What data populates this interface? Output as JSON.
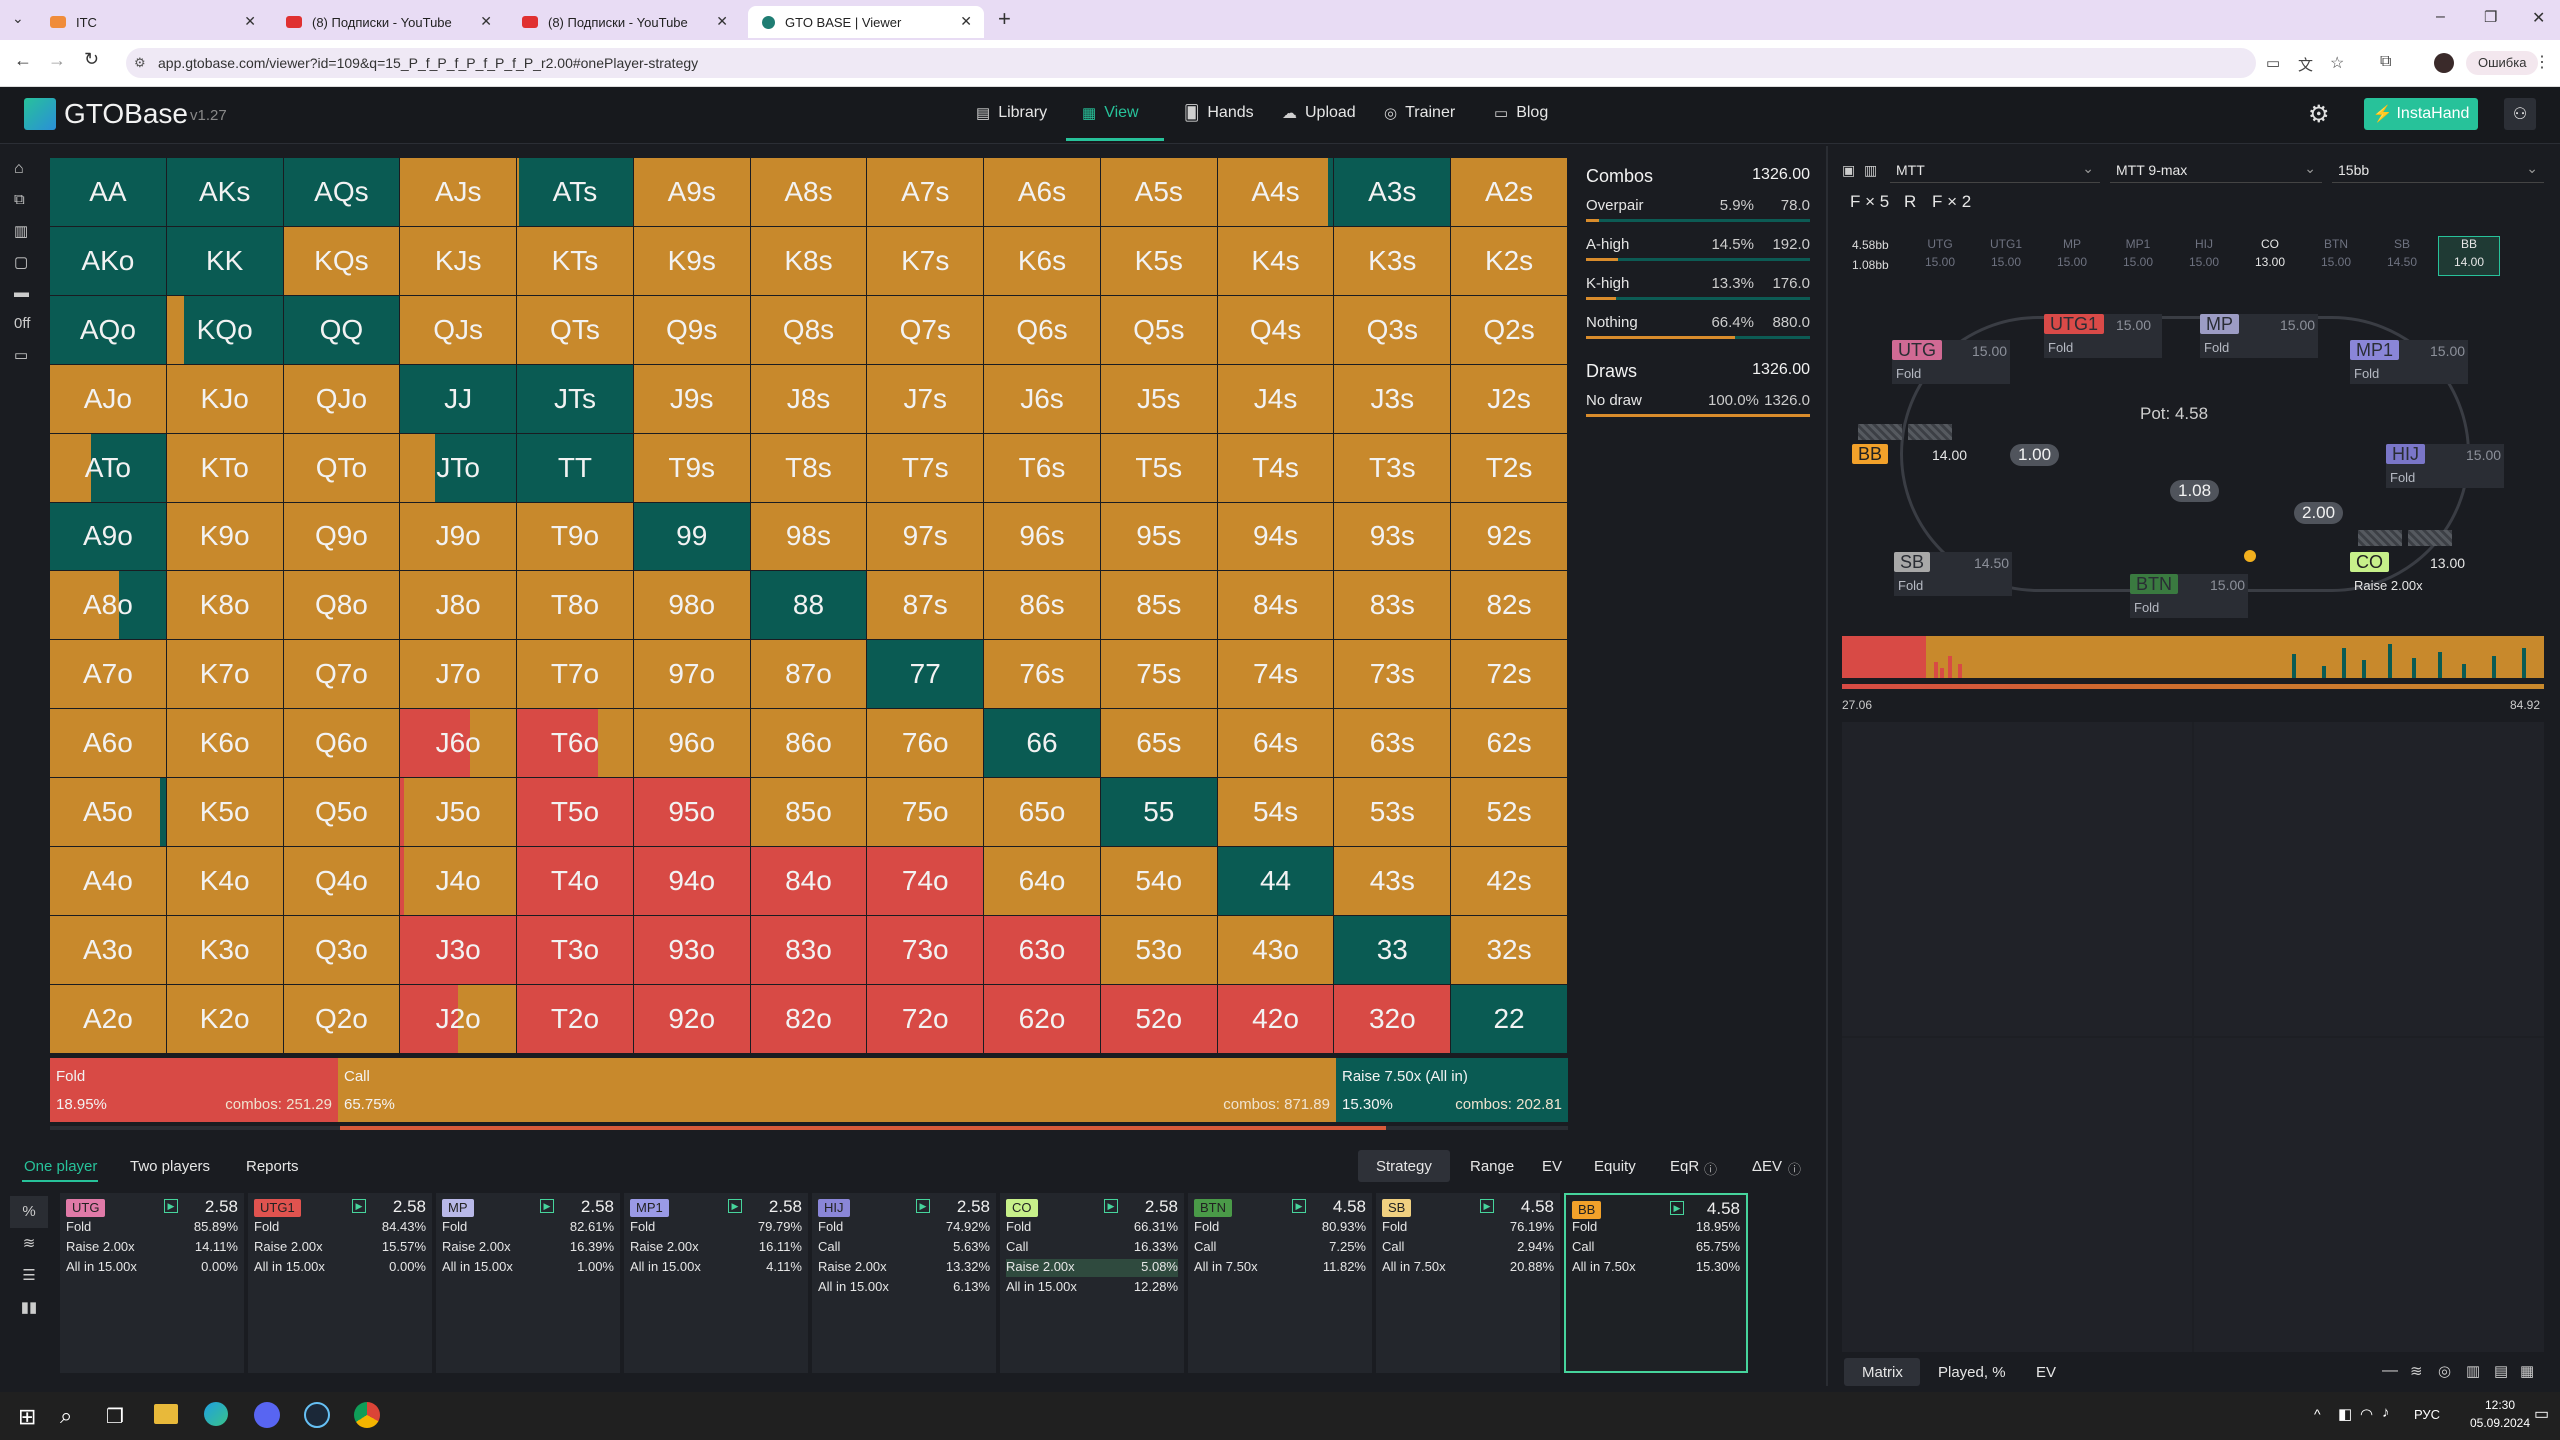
{
  "browser": {
    "tabs": [
      {
        "title": "ITC",
        "fav": "#f08c3a"
      },
      {
        "title": "(8) Подписки - YouTube",
        "fav": "#e03131"
      },
      {
        "title": "(8) Подписки - YouTube",
        "fav": "#e03131"
      },
      {
        "title": "GTO BASE | Viewer",
        "fav": "#1f7d73"
      }
    ],
    "url": "app.gtobase.com/viewer?id=109&q=15_P_f_P_f_P_f_P_f_P_r2.00#onePlayer-strategy",
    "profile_error": "Ошибка"
  },
  "app": {
    "brand": "GTOBase",
    "version": "v1.27",
    "nav": [
      {
        "label": "Library",
        "icon": "library-icon"
      },
      {
        "label": "View",
        "icon": "grid-icon"
      },
      {
        "label": "Hands",
        "icon": "hands-icon"
      },
      {
        "label": "Upload",
        "icon": "cloud-upload-icon"
      },
      {
        "label": "Trainer",
        "icon": "trainer-icon"
      },
      {
        "label": "Blog",
        "icon": "blog-icon"
      }
    ],
    "instahand": "InstaHand",
    "sidebar_text": "0ff"
  },
  "colors": {
    "fold": "#d84a45",
    "call": "#c8892c",
    "raise": "#0a5b53",
    "accent": "#27c29a"
  },
  "matrix": {
    "labels": [
      [
        "AA",
        "AKs",
        "AQs",
        "AJs",
        "ATs",
        "A9s",
        "A8s",
        "A7s",
        "A6s",
        "A5s",
        "A4s",
        "A3s",
        "A2s"
      ],
      [
        "AKo",
        "KK",
        "KQs",
        "KJs",
        "KTs",
        "K9s",
        "K8s",
        "K7s",
        "K6s",
        "K5s",
        "K4s",
        "K3s",
        "K2s"
      ],
      [
        "AQo",
        "KQo",
        "QQ",
        "QJs",
        "QTs",
        "Q9s",
        "Q8s",
        "Q7s",
        "Q6s",
        "Q5s",
        "Q4s",
        "Q3s",
        "Q2s"
      ],
      [
        "AJo",
        "KJo",
        "QJo",
        "JJ",
        "JTs",
        "J9s",
        "J8s",
        "J7s",
        "J6s",
        "J5s",
        "J4s",
        "J3s",
        "J2s"
      ],
      [
        "ATo",
        "KTo",
        "QTo",
        "JTo",
        "TT",
        "T9s",
        "T8s",
        "T7s",
        "T6s",
        "T5s",
        "T4s",
        "T3s",
        "T2s"
      ],
      [
        "A9o",
        "K9o",
        "Q9o",
        "J9o",
        "T9o",
        "99",
        "98s",
        "97s",
        "96s",
        "95s",
        "94s",
        "93s",
        "92s"
      ],
      [
        "A8o",
        "K8o",
        "Q8o",
        "J8o",
        "T8o",
        "98o",
        "88",
        "87s",
        "86s",
        "85s",
        "84s",
        "83s",
        "82s"
      ],
      [
        "A7o",
        "K7o",
        "Q7o",
        "J7o",
        "T7o",
        "97o",
        "87o",
        "77",
        "76s",
        "75s",
        "74s",
        "73s",
        "72s"
      ],
      [
        "A6o",
        "K6o",
        "Q6o",
        "J6o",
        "T6o",
        "96o",
        "86o",
        "76o",
        "66",
        "65s",
        "64s",
        "63s",
        "62s"
      ],
      [
        "A5o",
        "K5o",
        "Q5o",
        "J5o",
        "T5o",
        "95o",
        "85o",
        "75o",
        "65o",
        "55",
        "54s",
        "53s",
        "52s"
      ],
      [
        "A4o",
        "K4o",
        "Q4o",
        "J4o",
        "T4o",
        "94o",
        "84o",
        "74o",
        "64o",
        "54o",
        "44",
        "43s",
        "42s"
      ],
      [
        "A3o",
        "K3o",
        "Q3o",
        "J3o",
        "T3o",
        "93o",
        "83o",
        "73o",
        "63o",
        "53o",
        "43o",
        "33",
        "32s"
      ],
      [
        "A2o",
        "K2o",
        "Q2o",
        "J2o",
        "T2o",
        "92o",
        "82o",
        "72o",
        "62o",
        "52o",
        "42o",
        "32o",
        "22"
      ]
    ],
    "strategy_codes": [
      "GGGOOOOOOOOGO",
      "GGOOOOOOOOOOO",
      "GPGOOOOOOOOOO",
      "OOOGGOOOOOOOO",
      "POOPGOOOOOOOO",
      "GOOOOGOOOOOOO",
      "POOOOOGOOOOOO",
      "OOOOOOOGOOOOO",
      "OOORROOOGOOOO",
      "POORRROOOGOOO",
      "OOORRRRROOGOO",
      "OOORRRRRROOGO",
      "OOORRRRRRRRRG"
    ],
    "mixes": {
      "0,0": {
        "c": 0.0,
        "r": 1.0
      },
      "0,1": {
        "c": 0.0,
        "r": 1.0
      },
      "0,2": {
        "c": 0.0,
        "r": 1.0
      },
      "0,4": {
        "c": 0.02,
        "r": 0.98
      },
      "0,10": {
        "c": 0.95,
        "r": 0.05
      },
      "0,11": {
        "c": 0.0,
        "r": 1.0
      },
      "2,1": {
        "c": 0.15,
        "r": 0.85
      },
      "3,3": {
        "c": 0.0,
        "r": 1.0
      },
      "3,4": {
        "c": 0.0,
        "r": 1.0
      },
      "4,0": {
        "c": 0.35,
        "r": 0.65
      },
      "4,3": {
        "c": 0.3,
        "r": 0.7
      },
      "4,4": {
        "c": 0.0,
        "r": 1.0
      },
      "5,0": {
        "c": 0.0,
        "r": 1.0
      },
      "5,5": {
        "c": 0.0,
        "r": 1.0
      },
      "6,0": {
        "c": 0.6,
        "r": 0.4
      },
      "6,6": {
        "c": 0.0,
        "r": 1.0
      },
      "7,7": {
        "c": 0.0,
        "r": 1.0
      },
      "8,8": {
        "c": 0.0,
        "r": 1.0
      },
      "9,0": {
        "c": 0.95,
        "r": 0.05
      },
      "9,9": {
        "c": 0.0,
        "r": 1.0
      },
      "10,10": {
        "c": 0.0,
        "r": 1.0
      },
      "11,11": {
        "c": 0.0,
        "r": 1.0
      },
      "12,12": {
        "c": 0.0,
        "r": 1.0
      },
      "8,3": {
        "f": 0.6,
        "c": 0.4
      },
      "8,4": {
        "f": 0.7,
        "c": 0.3
      },
      "9,3": {
        "f": 0.03,
        "c": 0.97
      },
      "10,3": {
        "f": 0.03,
        "c": 0.97
      },
      "12,3": {
        "f": 0.5,
        "c": 0.5
      }
    }
  },
  "actions_summary": [
    {
      "name": "Fold",
      "pct": "18.95%",
      "combos": "combos: 251.29",
      "frac": 0.1895
    },
    {
      "name": "Call",
      "pct": "65.75%",
      "combos": "combos: 871.89",
      "frac": 0.6575
    },
    {
      "name": "Raise 7.50x (All in)",
      "pct": "15.30%",
      "combos": "combos: 202.81",
      "frac": 0.153
    }
  ],
  "stats": {
    "combos_title": "Combos",
    "combos_total": "1326.00",
    "rows": [
      {
        "name": "Overpair",
        "pct": "5.9%",
        "combos": "78.0",
        "frac": 0.059
      },
      {
        "name": "A-high",
        "pct": "14.5%",
        "combos": "192.0",
        "frac": 0.145
      },
      {
        "name": "K-high",
        "pct": "13.3%",
        "combos": "176.0",
        "frac": 0.133
      },
      {
        "name": "Nothing",
        "pct": "66.4%",
        "combos": "880.0",
        "frac": 0.664
      }
    ],
    "draws_title": "Draws",
    "draws_total": "1326.00",
    "draw_rows": [
      {
        "name": "No draw",
        "pct": "100.0%",
        "combos": "1326.0",
        "frac": 1.0
      }
    ]
  },
  "bottom_tabs": {
    "left": [
      "One player",
      "Two players",
      "Reports"
    ],
    "right": [
      "Strategy",
      "Range",
      "EV",
      "Equity",
      "EqR",
      "ΔEV"
    ]
  },
  "positions": [
    {
      "name": "UTG",
      "stack": "2.58",
      "color": "#e07aa8",
      "actions": [
        [
          "Fold",
          "85.89%"
        ],
        [
          "Raise 2.00x",
          "14.11%"
        ],
        [
          "All in 15.00x",
          "0.00%"
        ]
      ]
    },
    {
      "name": "UTG1",
      "stack": "2.58",
      "color": "#e0534f",
      "actions": [
        [
          "Fold",
          "84.43%"
        ],
        [
          "Raise 2.00x",
          "15.57%"
        ],
        [
          "All in 15.00x",
          "0.00%"
        ]
      ]
    },
    {
      "name": "MP",
      "stack": "2.58",
      "color": "#b8b8e8",
      "actions": [
        [
          "Fold",
          "82.61%"
        ],
        [
          "Raise 2.00x",
          "16.39%"
        ],
        [
          "All in 15.00x",
          "1.00%"
        ]
      ]
    },
    {
      "name": "MP1",
      "stack": "2.58",
      "color": "#9a9ae6",
      "actions": [
        [
          "Fold",
          "79.79%"
        ],
        [
          "Raise 2.00x",
          "16.11%"
        ],
        [
          "All in 15.00x",
          "4.11%"
        ]
      ]
    },
    {
      "name": "HIJ",
      "stack": "2.58",
      "color": "#8a86d8",
      "actions": [
        [
          "Fold",
          "74.92%"
        ],
        [
          "Call",
          "5.63%"
        ],
        [
          "Raise 2.00x",
          "13.32%"
        ],
        [
          "All in 15.00x",
          "6.13%"
        ]
      ]
    },
    {
      "name": "CO",
      "stack": "2.58",
      "color": "#c7f08a",
      "actions": [
        [
          "Fold",
          "66.31%"
        ],
        [
          "Call",
          "16.33%"
        ],
        [
          "Raise 2.00x",
          "5.08%"
        ],
        [
          "All in 15.00x",
          "12.28%"
        ]
      ]
    },
    {
      "name": "BTN",
      "stack": "4.58",
      "color": "#4a9a48",
      "actions": [
        [
          "Fold",
          "80.93%"
        ],
        [
          "Call",
          "7.25%"
        ],
        [
          "All in 7.50x",
          "11.82%"
        ]
      ]
    },
    {
      "name": "SB",
      "stack": "4.58",
      "color": "#f0d080",
      "actions": [
        [
          "Fold",
          "76.19%"
        ],
        [
          "Call",
          "2.94%"
        ],
        [
          "All in 7.50x",
          "20.88%"
        ]
      ]
    },
    {
      "name": "BB",
      "stack": "4.58",
      "color": "#f2a12a",
      "actions": [
        [
          "Fold",
          "18.95%"
        ],
        [
          "Call",
          "65.75%"
        ],
        [
          "All in 7.50x",
          "15.30%"
        ]
      ]
    }
  ],
  "side_icons": [
    "percent-icon",
    "chart-icon",
    "list-icon",
    "cards-icon"
  ],
  "right": {
    "selects": [
      "MTT",
      "MTT 9-max",
      "15bb"
    ],
    "line": [
      "F × 5",
      "R",
      "F × 2"
    ],
    "pot_left": "4.58bb",
    "pot_left2": "1.08bb",
    "pos_row": [
      {
        "n": "UTG",
        "v": "15.00"
      },
      {
        "n": "UTG1",
        "v": "15.00"
      },
      {
        "n": "MP",
        "v": "15.00"
      },
      {
        "n": "MP1",
        "v": "15.00"
      },
      {
        "n": "HIJ",
        "v": "15.00"
      },
      {
        "n": "CO",
        "v": "13.00"
      },
      {
        "n": "BTN",
        "v": "15.00"
      },
      {
        "n": "SB",
        "v": "14.50"
      },
      {
        "n": "BB",
        "v": "14.00"
      }
    ],
    "pot": "Pot: 4.58",
    "seats": [
      {
        "n": "UTG",
        "st": "15.00",
        "a": "Fold",
        "color": "#d06a94"
      },
      {
        "n": "UTG1",
        "st": "15.00",
        "a": "Fold",
        "color": "#d94a48"
      },
      {
        "n": "MP",
        "st": "15.00",
        "a": "Fold",
        "color": "#9c9cc4"
      },
      {
        "n": "MP1",
        "st": "15.00",
        "a": "Fold",
        "color": "#8a86d8"
      },
      {
        "n": "HIJ",
        "st": "15.00",
        "a": "Fold",
        "color": "#7a76c8"
      },
      {
        "n": "CO",
        "st": "13.00",
        "a": "Raise 2.00x",
        "color": "#c7f08a"
      },
      {
        "n": "BTN",
        "st": "15.00",
        "a": "Fold",
        "color": "#3a7a40"
      },
      {
        "n": "SB",
        "st": "14.50",
        "a": "Fold",
        "color": "#a8a8a8"
      },
      {
        "n": "BB",
        "st": "14.00",
        "a": "",
        "color": "#f2a12a"
      }
    ],
    "chips": [
      "1.00",
      "1.08",
      "2.00"
    ],
    "ev_min": "27.06",
    "ev_max": "84.92",
    "bottom_tabs": [
      "Matrix",
      "Played, %",
      "EV"
    ]
  },
  "taskbar": {
    "lang": "РУС",
    "time": "12:30",
    "date": "05.09.2024"
  }
}
